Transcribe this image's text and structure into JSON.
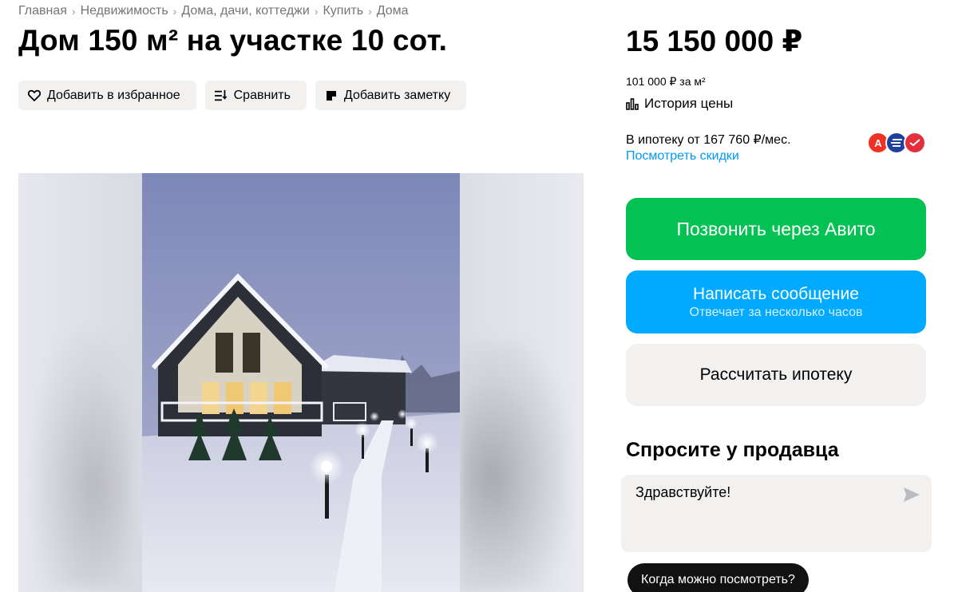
{
  "breadcrumb": [
    "Главная",
    "Недвижимость",
    "Дома, дачи, коттеджи",
    "Купить",
    "Дома"
  ],
  "title": "Дом 150 м² на участке 10 сот.",
  "actions": {
    "favorite": "Добавить в избранное",
    "compare": "Сравнить",
    "note": "Добавить заметку"
  },
  "price": {
    "value": "15 150 000 ₽",
    "per_meter": "101 000 ₽ за м²",
    "history": "История цены"
  },
  "mortgage": {
    "text": "В ипотеку от 167 760 ₽/мес.",
    "discounts_link": "Посмотреть скидки",
    "banks": [
      {
        "icon": "alfa-bank-icon",
        "letter": "А",
        "color": "#ef3124"
      },
      {
        "icon": "bank-stripes-icon",
        "letter": "",
        "color": "#1d3f9e"
      },
      {
        "icon": "bank-check-icon",
        "letter": "",
        "color": "#e4303c"
      }
    ]
  },
  "buttons": {
    "call": "Позвонить через Авито",
    "message": "Написать сообщение",
    "message_sub": "Отвечает за несколько часов",
    "mortgage_calc": "Рассчитать ипотеку"
  },
  "ask": {
    "title": "Спросите у продавца",
    "message_value": "Здравствуйте!",
    "quick_reply": "Когда можно посмотреть?"
  },
  "colors": {
    "green": "#04c154",
    "blue": "#01aaff",
    "link": "#0099f7",
    "gray_bg": "#f2f1f0"
  }
}
